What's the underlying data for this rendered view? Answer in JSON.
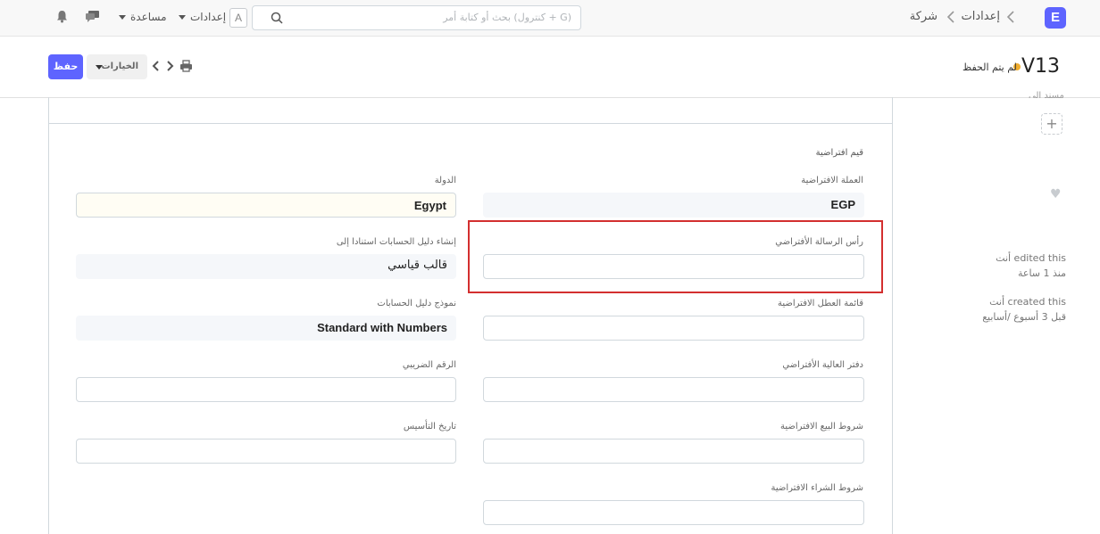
{
  "navbar": {
    "logo_letter": "E",
    "breadcrumb": [
      "إعدادات",
      "شركة"
    ],
    "search_placeholder": "بحث أو كتابة أمر (كنترول + G)",
    "avatar_letter": "A",
    "settings_label": "إعدادات",
    "help_label": "مساعدة"
  },
  "page": {
    "title": "V13",
    "status": "لم يتم الحفظ",
    "save_label": "حفظ",
    "options_label": "الخيارات"
  },
  "form": {
    "section_title": "قيم افتراضية",
    "right_col": [
      {
        "label": "العملة الافتراضية",
        "value": "EGP"
      },
      {
        "label": "رأس الرسالة الأفتراضي",
        "value": ""
      },
      {
        "label": "قائمة العطل الافتراضية",
        "value": ""
      },
      {
        "label": "دفتر العالية الأفتراضي",
        "value": ""
      },
      {
        "label": "شروط البيع الافتراضية",
        "value": ""
      },
      {
        "label": "شروط الشراء الافتراضية",
        "value": ""
      }
    ],
    "left_col": [
      {
        "label": "الدولة",
        "value": "Egypt"
      },
      {
        "label": "إنشاء دليل الحسابات استنادا إلى",
        "value": "قالب قياسي"
      },
      {
        "label": "نموذج دليل الحسابات",
        "value": "Standard with Numbers"
      },
      {
        "label": "الرقم الضريبي",
        "value": ""
      },
      {
        "label": "تاريخ التأسيس",
        "value": ""
      }
    ]
  },
  "sidebar": {
    "assigned_label": "مسند إلى",
    "edited_line1": "أنت edited this",
    "edited_line2": "منذ 1 ساعة",
    "created_line1": "أنت created this",
    "created_line2": "قبل 3 أسبوع /أسابيع"
  },
  "colors": {
    "primary": "#5e64ff",
    "unsaved_dot": "#f0ad2e",
    "highlight_border": "#d32f2f"
  }
}
